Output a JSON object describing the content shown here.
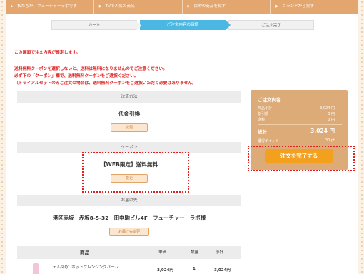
{
  "nav": {
    "items": [
      {
        "label": "私たちが、フューチャーラボです"
      },
      {
        "label": "TVで人気の商品"
      },
      {
        "label": "目的の商品を探す"
      },
      {
        "label": "ブランドから探す"
      }
    ]
  },
  "steps": [
    {
      "label": "カート",
      "active": false
    },
    {
      "label": "ご注文内容の確認",
      "active": true
    },
    {
      "label": "ご注文完了",
      "active": false
    }
  ],
  "notices": {
    "confirm": "この画面で注文内容が確定します。",
    "coupon_warning": "送料無料クーポンを選択しないと、送料は無料になりませんのでご注意ください。",
    "coupon_instruction": "必ず下の「クーポン」欄で、送料無料クーポンをご選択ください。",
    "trial_note": "（トライアルセットのみご注文の場合は、送料無料クーポンをご選択いただく必要はありません）"
  },
  "payment": {
    "heading": "決済方法",
    "value": "代金引換",
    "button": "変更"
  },
  "coupon": {
    "heading": "クーポン",
    "value": "【WEB限定】送料無料",
    "button": "変更"
  },
  "delivery": {
    "heading": "お届け先",
    "address": "港区赤坂　赤坂8-5-32　田中駒ビル4F　フューチャー　ラボ様",
    "button": "お届け先変更"
  },
  "table": {
    "headers": {
      "product": "商品",
      "unit_price": "単価",
      "quantity": "数量",
      "subtotal": "小計"
    },
    "rows": [
      {
        "name": "デルマQ1 ホットクレンジングバーム",
        "unit_price": "3,024円",
        "quantity": "1",
        "subtotal": "3,024円"
      }
    ]
  },
  "summary": {
    "title": "ご注文内容",
    "rows": [
      {
        "label": "商品小計",
        "value": "3,024 円"
      },
      {
        "label": "割引額",
        "value": "0 円"
      },
      {
        "label": "送料",
        "value": "0 円"
      }
    ],
    "total_label": "総計",
    "total_value": "3,024 円",
    "points_label": "獲得ポイント",
    "points_value": "30 pt",
    "submit": "注文を完了する"
  },
  "colors": {
    "nav": "#e3a66e",
    "step_active": "#4bb8e4",
    "notice": "#e02020",
    "sidebar": "#dcab77",
    "submit": "#f3a01f",
    "highlight": "#e32020"
  }
}
